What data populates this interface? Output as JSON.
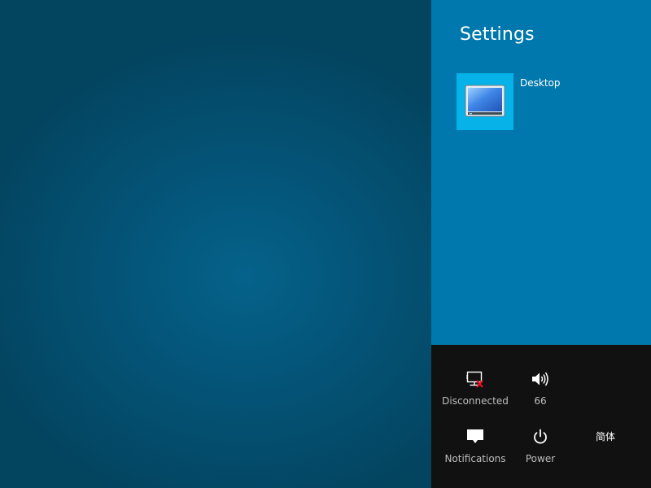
{
  "settings_pane": {
    "title": "Settings",
    "tiles": [
      {
        "label": "Desktop",
        "icon": "desktop-monitor-icon"
      }
    ]
  },
  "quick_settings": {
    "network": {
      "label": "Disconnected",
      "icon": "network-disconnected-icon"
    },
    "volume": {
      "label": "66",
      "icon": "speaker-icon"
    },
    "notifications": {
      "label": "Notifications",
      "icon": "notifications-icon"
    },
    "power": {
      "label": "Power",
      "icon": "power-icon"
    },
    "keyboard": {
      "label": "简体"
    }
  },
  "colors": {
    "desktop_background": "#03445f",
    "charm_panel": "#0078ad",
    "tile_accent": "#06b2e8",
    "quick_settings_background": "#111111"
  }
}
